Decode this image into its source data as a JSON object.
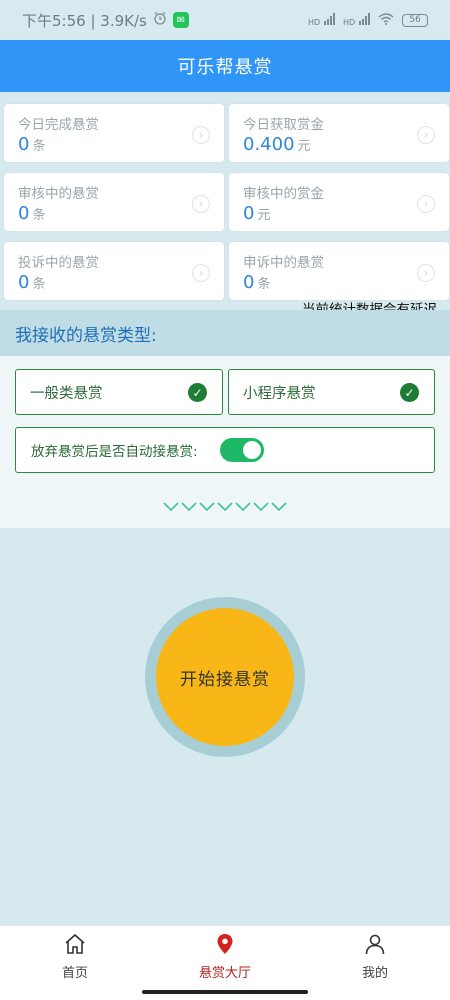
{
  "status_bar": {
    "time_speed": "下午5:56 | 3.9K/s",
    "alarm_icon": "alarm-icon",
    "app_badge": "wechat-icon",
    "signal_1": "HD",
    "signal_2": "HD",
    "battery": "56"
  },
  "header": {
    "title": "可乐帮悬赏"
  },
  "stats": {
    "today_completed": {
      "label": "今日完成悬赏",
      "value": "0",
      "unit": "条"
    },
    "today_earned": {
      "label": "今日获取赏金",
      "value": "0.400",
      "unit": "元"
    },
    "reviewing_rewards": {
      "label": "审核中的悬赏",
      "value": "0",
      "unit": "条"
    },
    "reviewing_money": {
      "label": "审核中的赏金",
      "value": "0",
      "unit": "元"
    },
    "complaining": {
      "label": "投诉中的悬赏",
      "value": "0",
      "unit": "条"
    },
    "appealing": {
      "label": "申诉中的悬赏",
      "value": "0",
      "unit": "条"
    },
    "delay_note": "当前统计数据会有延迟"
  },
  "reward_types": {
    "title": "我接收的悬赏类型:",
    "options": [
      {
        "label": "一般类悬赏",
        "checked": true
      },
      {
        "label": "小程序悬赏",
        "checked": true
      }
    ],
    "auto_accept_label": "放弃悬赏后是否自动接悬赏:",
    "auto_accept_on": true
  },
  "start_button": {
    "label": "开始接悬赏"
  },
  "colors": {
    "header": "#2f95f6",
    "accent_green": "#1e7c34",
    "start_button": "#f8b716",
    "active_nav": "#b21f1f"
  },
  "bottom_nav": {
    "home": "首页",
    "hall": "悬赏大厅",
    "mine": "我的"
  }
}
